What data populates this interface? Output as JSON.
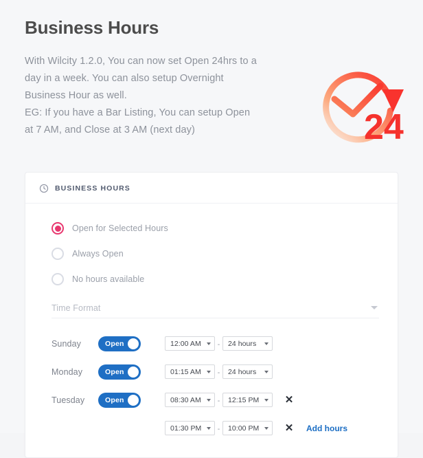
{
  "page": {
    "title": "Business Hours",
    "description_lines": [
      "With Wilcity 1.2.0, You can now set Open 24hrs to a",
      "day in a week. You can also setup Overnight",
      "Business Hour as well.",
      "EG: If you have a Bar Listing, You can setup Open",
      "at 7 AM, and Close at 3 AM (next day)"
    ],
    "background_color": "#f6f7f9"
  },
  "badge": {
    "icon_name": "clock-24-hours-icon",
    "text": "24",
    "gradient_from": "#ffcdb0",
    "gradient_to": "#f9332e",
    "text_color": "#f5322d"
  },
  "card": {
    "header": {
      "icon_name": "clock-icon",
      "title": "BUSINESS HOURS"
    },
    "radios": [
      {
        "label": "Open for Selected Hours",
        "checked": true
      },
      {
        "label": "Always Open",
        "checked": false
      },
      {
        "label": "No hours available",
        "checked": false
      }
    ],
    "radio_accent_color": "#e8376f",
    "time_format": {
      "label": "Time Format",
      "caret_icon": "chevron-down-icon"
    },
    "toggle_color": "#1f6fc4",
    "link_color": "#1c6ec4",
    "remove_icon": "✕",
    "days": [
      {
        "name": "Sunday",
        "toggle_label": "Open",
        "toggle_on": true,
        "open_time": "12:00 AM",
        "close_time": "24 hours",
        "removable": false
      },
      {
        "name": "Monday",
        "toggle_label": "Open",
        "toggle_on": true,
        "open_time": "01:15 AM",
        "close_time": "24 hours",
        "removable": false
      },
      {
        "name": "Tuesday",
        "toggle_label": "Open",
        "toggle_on": true,
        "open_time": "08:30 AM",
        "close_time": "12:15 PM",
        "removable": true
      }
    ],
    "extra_row": {
      "open_time": "01:30 PM",
      "close_time": "10:00 PM",
      "add_label": "Add hours"
    },
    "separator": "-"
  }
}
